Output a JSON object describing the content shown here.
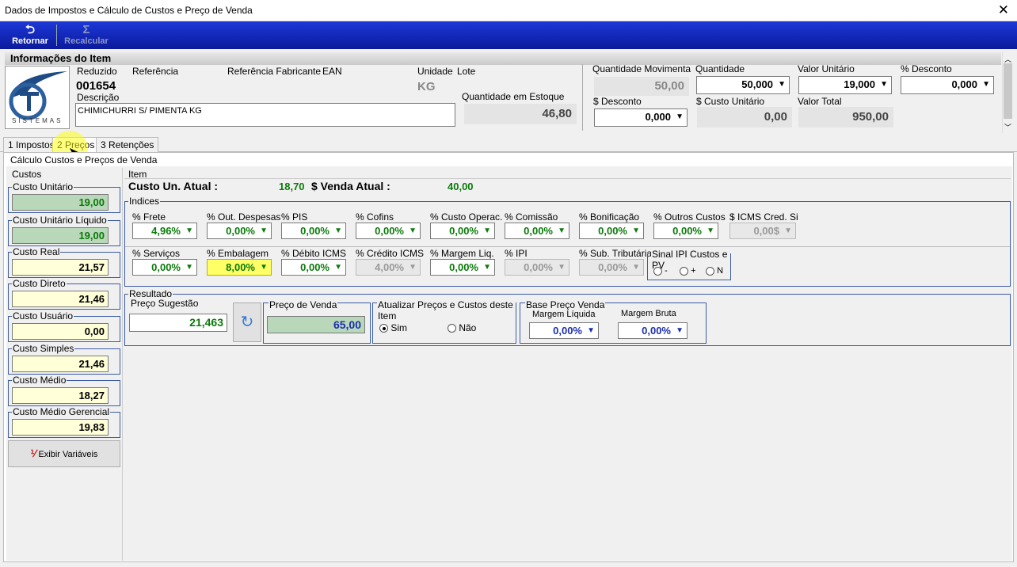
{
  "window": {
    "title": "Dados de Impostos e Cálculo de Custos e Preço de Venda",
    "close": "✕"
  },
  "toolbar": {
    "retornar": "Retornar",
    "recalcular": "Recalcular",
    "retornar_icon": "⮌",
    "recalcular_icon": "Σ"
  },
  "info": {
    "header": "Informações do Item",
    "logo_text": "SISTEMAS",
    "reduzido_label": "Reduzido",
    "reduzido": "001654",
    "referencia_label": "Referência",
    "ref_fab_label": "Referência Fabricante",
    "ean_label": "EAN",
    "unidade_label": "Unidade",
    "unidade": "KG",
    "lote_label": "Lote",
    "descricao_label": "Descrição",
    "descricao": "CHIMICHURRI S/ PIMENTA KG",
    "qtd_estoque_label": "Quantidade em Estoque",
    "qtd_estoque": "46,80",
    "qtd_mov_label": "Quantidade Movimenta",
    "qtd_mov": "50,00",
    "qtd_label": "Quantidade",
    "qtd": "50,000",
    "valor_unit_label": "Valor Unitário",
    "valor_unit": "19,000",
    "pct_desc_label": "% Desconto",
    "pct_desc": "0,000",
    "desc_label": "$ Desconto",
    "desc": "0,000",
    "custo_unit_label": "$ Custo Unitário",
    "custo_unit": "0,00",
    "valor_total_label": "Valor Total",
    "valor_total": "950,00"
  },
  "tabs": [
    "1 Impostos",
    "2 Preços",
    "3 Retenções"
  ],
  "section_title": "Cálculo Custos e Preços de Venda",
  "custos": {
    "title": "Custos",
    "items": [
      {
        "label": "Custo Unitário",
        "value": "19,00"
      },
      {
        "label": "Custo Unitário Líquido",
        "value": "19,00"
      },
      {
        "label": "Custo Real",
        "value": "21,57"
      },
      {
        "label": "Custo Direto",
        "value": "21,46"
      },
      {
        "label": "Custo Usuário",
        "value": "0,00"
      },
      {
        "label": "Custo Simples",
        "value": "21,46"
      },
      {
        "label": "Custo Médio",
        "value": "18,27"
      },
      {
        "label": "Custo Médio Gerencial",
        "value": "19,83"
      }
    ],
    "exibir": "Exibir Variáveis"
  },
  "item": {
    "title": "Item",
    "custo_label": "Custo Un. Atual :",
    "custo": "18,70",
    "venda_label": "$ Venda Atual :",
    "venda": "40,00"
  },
  "indices": {
    "title": "Indices",
    "row1": [
      {
        "label": "% Frete",
        "value": "4,96%"
      },
      {
        "label": "% Out. Despesas",
        "value": "0,00%"
      },
      {
        "label": "% PIS",
        "value": "0,00%"
      },
      {
        "label": "% Cofins",
        "value": "0,00%"
      },
      {
        "label": "% Custo Operac.",
        "value": "0,00%"
      },
      {
        "label": "% Comissão",
        "value": "0,00%"
      },
      {
        "label": "% Bonificação",
        "value": "0,00%"
      },
      {
        "label": "% Outros Custos",
        "value": "0,00%"
      },
      {
        "label": "$ ICMS Cred. Simp",
        "value": "0,00$"
      }
    ],
    "row2": [
      {
        "label": "% Serviços",
        "value": "0,00%"
      },
      {
        "label": "% Embalagem",
        "value": "8,00%"
      },
      {
        "label": "% Débito ICMS",
        "value": "0,00%"
      },
      {
        "label": "% Crédito ICMS",
        "value": "4,00%"
      },
      {
        "label": "% Margem Liq.",
        "value": "0,00%"
      },
      {
        "label": "% IPI",
        "value": "0,00%"
      },
      {
        "label": "% Sub. Tributária",
        "value": "0,00%"
      }
    ],
    "sinal": {
      "title": "Sinal IPI Custos e PV",
      "opts": [
        "-",
        "+",
        "N"
      ]
    }
  },
  "resultado": {
    "title": "Resultado",
    "sugestao_label": "Preço Sugestão",
    "sugestao": "21,463",
    "refresh_icon": "↻",
    "venda_label": "Preço de Venda",
    "venda": "65,00",
    "atualizar_title": "Atualizar Preços e Custos deste Item",
    "sim": "Sim",
    "nao": "Não",
    "base_title": "Base Preço Venda",
    "margem_liq_label": "Margem Líquida",
    "margem_liq": "0,00%",
    "margem_bruta_label": "Margem Bruta",
    "margem_bruta": "0,00%"
  }
}
